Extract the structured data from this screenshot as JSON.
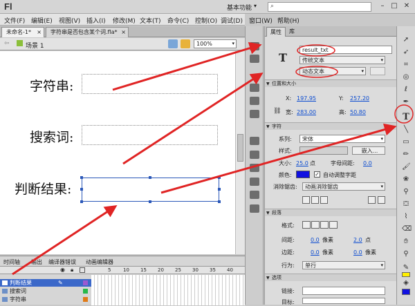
{
  "app": {
    "logo": "Fl",
    "workspace": "基本功能",
    "search_icon": "⌕",
    "win_min": "–",
    "win_max": "□",
    "win_close": "✕"
  },
  "menu": [
    "文件(F)",
    "编辑(E)",
    "视图(V)",
    "插入(I)",
    "修改(M)",
    "文本(T)",
    "命令(C)",
    "控制(O)",
    "调试(D)",
    "窗口(W)",
    "帮助(H)"
  ],
  "doc_tabs": [
    {
      "label": "未命名-1*",
      "close": "×"
    },
    {
      "label": "字符串是否包含某个词.fla*",
      "close": "×"
    }
  ],
  "editbar": {
    "scene": "场景 1",
    "zoom": "100%"
  },
  "stage": {
    "labels": [
      "字符串:",
      "搜索词:",
      "判断结果:"
    ]
  },
  "timeline": {
    "tabs": [
      "时间轴",
      "输出",
      "编译器错误",
      "动画编辑器"
    ],
    "frame_numbers": [
      "5",
      "10",
      "15",
      "20",
      "25",
      "30",
      "35",
      "40"
    ],
    "layers": [
      "判断结果",
      "搜索词",
      "字符串"
    ],
    "layer_colors": [
      "#9b59d0",
      "#27b84a",
      "#e07a17"
    ]
  },
  "properties": {
    "tabs": [
      "属性",
      "库"
    ],
    "instance_name": "result_txt",
    "text_engine": "传统文本",
    "text_type": "动态文本",
    "sections": {
      "position": "位置和大小",
      "char": "字符",
      "paragraph": "段落",
      "options": "选项"
    },
    "x_label": "X:",
    "x": "197.95",
    "y_label": "Y:",
    "y": "257.20",
    "w_label": "宽:",
    "w": "283.00",
    "h_label": "高:",
    "h": "50.80",
    "family_label": "系列:",
    "family": "宋体",
    "style_label": "样式:",
    "embed": "嵌入...",
    "size_label": "大小:",
    "size": "25.0",
    "size_unit": "点",
    "spacing_label": "字母间距:",
    "spacing": "0.0",
    "color_label": "颜色:",
    "text_color": "#1010e0",
    "autokern": "自动调整字距",
    "aa_label": "消除锯齿:",
    "aa": "动画消除锯齿",
    "format_label": "格式:",
    "indent_label": "间距:",
    "indent": "0.0",
    "indent_unit": "像素",
    "line_sp": "2.0",
    "line_unit": "点",
    "margin_label": "边距:",
    "margin_l": "0.0",
    "margin_l_unit": "像素",
    "margin_r": "0.0",
    "margin_r_unit": "像素",
    "behavior_label": "行为:",
    "behavior": "单行",
    "link_label": "链接:",
    "target_label": "目标:"
  },
  "colors": {
    "annotation": "#e02424",
    "selection": "#2a57b8"
  }
}
